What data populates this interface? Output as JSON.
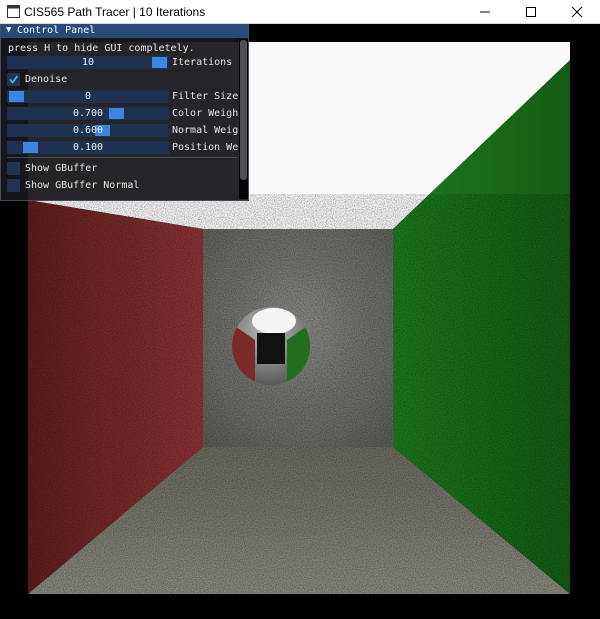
{
  "window": {
    "title": "CIS565 Path Tracer | 10 Iterations",
    "icon": "app-window-icon",
    "buttons": [
      "minimize-icon",
      "maximize-icon",
      "close-icon"
    ]
  },
  "panel": {
    "title": "Control Panel",
    "collapse_icon": "▼",
    "hint": "press H to hide GUI completely.",
    "iterations": {
      "label": "Iterations",
      "value": "10",
      "fraction": 1.0
    },
    "denoise": {
      "label": "Denoise",
      "checked": true
    },
    "filter_size": {
      "label": "Filter Size",
      "value": "0",
      "fraction": 0.0
    },
    "color_weight": {
      "label": "Color Weight",
      "value": "0.700",
      "fraction": 0.7
    },
    "normal_weight": {
      "label": "Normal Weight",
      "value": "0.600",
      "fraction": 0.6
    },
    "position_weight": {
      "label": "Position Weight",
      "value": "0.100",
      "fraction": 0.1
    },
    "show_gbuffer": {
      "label": "Show GBuffer",
      "checked": false
    },
    "show_gbuffer_normal": {
      "label": "Show GBuffer Normal",
      "checked": false
    }
  },
  "colors": {
    "header": "#29497a",
    "slider_bg": "#1e3150",
    "slider_grab": "#3d85e0",
    "left_wall": "#8a2a2a",
    "right_wall": "#1f7a1f",
    "back_wall": "#7a7a7a"
  }
}
